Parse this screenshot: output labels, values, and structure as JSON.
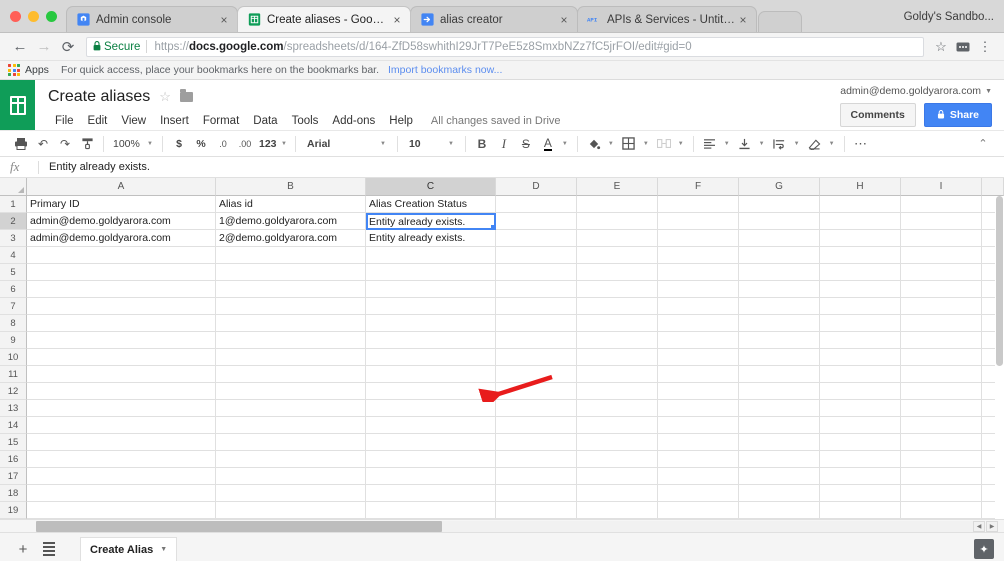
{
  "browser": {
    "tabs": [
      {
        "title": "Admin console",
        "favicon": "admin-console-icon",
        "active": false,
        "close": "×"
      },
      {
        "title": "Create aliases - Google Sheets",
        "favicon": "google-sheets-icon",
        "active": true,
        "close": "×"
      },
      {
        "title": "alias creator",
        "favicon": "apps-script-icon",
        "active": false,
        "close": "×"
      },
      {
        "title": "APIs & Services - Untitled proj",
        "favicon": "api-icon",
        "active": false,
        "close": "×"
      }
    ],
    "profile_name": "Goldy's Sandbo...",
    "nav": {
      "back": "←",
      "forward": "→",
      "reload": "⟳"
    },
    "omnibox": {
      "secure_label": "Secure",
      "lock_icon": "lock-icon",
      "url_scheme": "https://",
      "url_host": "docs.google.com",
      "url_path": "/spreadsheets/d/164-ZfD58swhithI29JrT7PeE5z8SmxbNZz7fC5jrFOI/edit#gid=0",
      "star_icon": "☆",
      "extension_icon": "⋯",
      "menu_icon": "⋮"
    },
    "bookmarks": {
      "apps_label": "Apps",
      "hint": "For quick access, place your bookmarks here on the bookmarks bar.",
      "import_link": "Import bookmarks now..."
    }
  },
  "sheets": {
    "doc_title": "Create aliases",
    "star_icon": "☆",
    "folder_icon": "folder-icon",
    "menus": [
      "File",
      "Edit",
      "View",
      "Insert",
      "Format",
      "Data",
      "Tools",
      "Add-ons",
      "Help"
    ],
    "save_status": "All changes saved in Drive",
    "account_email": "admin@demo.goldyarora.com",
    "comments_label": "Comments",
    "share_label": "Share",
    "toolbar": {
      "print": "⎙",
      "undo": "↶",
      "redo": "↷",
      "paint_format": "paint-format-icon",
      "zoom": "100%",
      "currency": "$",
      "percent": "%",
      "decrease_decimal": ".0",
      "increase_decimal": ".00",
      "more_formats": "123",
      "font": "Arial",
      "font_size": "10",
      "bold": "B",
      "italic": "I",
      "strikethrough": "S",
      "text_color": "A",
      "fill_color": "fill-color-icon",
      "borders": "borders-icon",
      "merge_cells": "merge-cells-icon",
      "halign": "horizontal-align-icon",
      "valign": "vertical-align-icon",
      "text_wrap": "text-wrap-icon",
      "text_rotation": "text-rotation-icon",
      "more": "⋯",
      "collapse": "⌃"
    },
    "formula_bar": {
      "fx_label": "fx",
      "value": "Entity already exists."
    },
    "grid": {
      "columns": [
        "A",
        "B",
        "C",
        "D",
        "E",
        "F",
        "G",
        "H",
        "I"
      ],
      "selected_column": "C",
      "selected_cell": "C2",
      "rows": [
        {
          "num": "1",
          "cells": [
            "Primary ID",
            "Alias id",
            "Alias Creation Status",
            "",
            "",
            "",
            "",
            "",
            ""
          ]
        },
        {
          "num": "2",
          "cells": [
            "admin@demo.goldyarora.com",
            "1@demo.goldyarora.com",
            "Entity already exists.",
            "",
            "",
            "",
            "",
            "",
            ""
          ]
        },
        {
          "num": "3",
          "cells": [
            "admin@demo.goldyarora.com",
            "2@demo.goldyarora.com",
            "Entity already exists.",
            "",
            "",
            "",
            "",
            "",
            ""
          ]
        },
        {
          "num": "4",
          "cells": [
            "",
            "",
            "",
            "",
            "",
            "",
            "",
            "",
            ""
          ]
        },
        {
          "num": "5",
          "cells": [
            "",
            "",
            "",
            "",
            "",
            "",
            "",
            "",
            ""
          ]
        },
        {
          "num": "6",
          "cells": [
            "",
            "",
            "",
            "",
            "",
            "",
            "",
            "",
            ""
          ]
        },
        {
          "num": "7",
          "cells": [
            "",
            "",
            "",
            "",
            "",
            "",
            "",
            "",
            ""
          ]
        },
        {
          "num": "8",
          "cells": [
            "",
            "",
            "",
            "",
            "",
            "",
            "",
            "",
            ""
          ]
        },
        {
          "num": "9",
          "cells": [
            "",
            "",
            "",
            "",
            "",
            "",
            "",
            "",
            ""
          ]
        },
        {
          "num": "10",
          "cells": [
            "",
            "",
            "",
            "",
            "",
            "",
            "",
            "",
            ""
          ]
        },
        {
          "num": "11",
          "cells": [
            "",
            "",
            "",
            "",
            "",
            "",
            "",
            "",
            ""
          ]
        },
        {
          "num": "12",
          "cells": [
            "",
            "",
            "",
            "",
            "",
            "",
            "",
            "",
            ""
          ]
        },
        {
          "num": "13",
          "cells": [
            "",
            "",
            "",
            "",
            "",
            "",
            "",
            "",
            ""
          ]
        },
        {
          "num": "14",
          "cells": [
            "",
            "",
            "",
            "",
            "",
            "",
            "",
            "",
            ""
          ]
        },
        {
          "num": "15",
          "cells": [
            "",
            "",
            "",
            "",
            "",
            "",
            "",
            "",
            ""
          ]
        },
        {
          "num": "16",
          "cells": [
            "",
            "",
            "",
            "",
            "",
            "",
            "",
            "",
            ""
          ]
        },
        {
          "num": "17",
          "cells": [
            "",
            "",
            "",
            "",
            "",
            "",
            "",
            "",
            ""
          ]
        },
        {
          "num": "18",
          "cells": [
            "",
            "",
            "",
            "",
            "",
            "",
            "",
            "",
            ""
          ]
        },
        {
          "num": "19",
          "cells": [
            "",
            "",
            "",
            "",
            "",
            "",
            "",
            "",
            ""
          ]
        }
      ]
    },
    "bottom": {
      "add_sheet": "+",
      "all_sheets": "all-sheets-icon",
      "sheet_tab_name": "Create Alias",
      "explore": "explore-icon"
    }
  },
  "annotation": {
    "type": "red-arrow",
    "points_to": "C2",
    "color": "#e81c1c"
  },
  "colors": {
    "sheets_green": "#0f9d58",
    "share_blue": "#4285f4",
    "selection_blue": "#4285f4",
    "secure_green": "#0b8043",
    "annotation_red": "#e81c1c"
  }
}
